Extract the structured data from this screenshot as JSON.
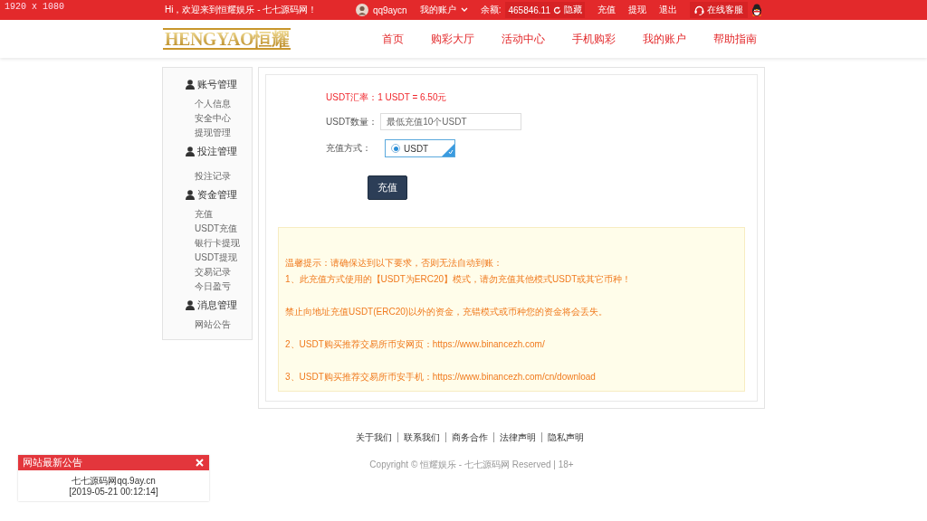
{
  "resolution_label": "1920 x 1080",
  "top_bar": {
    "greeting": "Hi，欢迎来到恒耀娱乐 - 七七源码网！",
    "username": "qq9aycn",
    "account_menu": "我的账户",
    "balance_label": "余额:",
    "balance": "465846.11",
    "hide_button": "隐藏",
    "links": [
      "充值",
      "提现",
      "退出"
    ],
    "support": "在线客服"
  },
  "header": {
    "logo": "HENGYAO恒耀",
    "nav": [
      {
        "label": "首页",
        "selected": false
      },
      {
        "label": "购彩大厅",
        "selected": false
      },
      {
        "label": "活动中心",
        "selected": false
      },
      {
        "label": "手机购彩",
        "selected": false
      },
      {
        "label": "我的账户",
        "selected": false
      },
      {
        "label": "帮助指南",
        "selected": false
      }
    ]
  },
  "sidebar": {
    "groups": [
      {
        "title": "账号管理",
        "items": [
          "个人信息",
          "安全中心",
          "提现管理"
        ]
      },
      {
        "title": "投注管理",
        "items": [
          "投注记录"
        ]
      },
      {
        "title": "资金管理",
        "items": [
          "充值",
          "USDT充值",
          "银行卡提现",
          "USDT提现",
          "交易记录",
          "今日盈亏"
        ]
      },
      {
        "title": "消息管理",
        "items": [
          "网站公告"
        ]
      }
    ]
  },
  "deposit": {
    "exchange_rate": "USDT汇率：1 USDT = 6.50元",
    "amount_label": "USDT数量：",
    "amount_placeholder": "最低充值10个USDT",
    "method_label": "充值方式：",
    "methods": [
      {
        "label": "USDT",
        "selected": true
      }
    ],
    "submit": "充值",
    "notice": [
      "温馨提示：请确保达到以下要求，否则无法自动到账：",
      "1、此充值方式使用的【USDT为ERC20】模式，请勿充值其他模式USDT或其它币种！",
      "禁止向地址充值USDT(ERC20)以外的资金，充错模式或币种您的资金将会丢失。",
      "2、USDT购买推荐交易所币安网页：https://www.binancezh.com/",
      "3、USDT购买推荐交易所币安手机：https://www.binancezh.com/cn/download"
    ]
  },
  "footer": {
    "links": [
      "关于我们",
      "联系我们",
      "商务合作",
      "法律声明",
      "隐私声明"
    ],
    "copyright": "Copyright © 恒耀娱乐 - 七七源码网 Reserved | 18+"
  },
  "announcement": {
    "title": "网站最新公告",
    "body": "七七源码网qq.9ay.cn",
    "time": "[2019-05-21 00:12:14]"
  }
}
